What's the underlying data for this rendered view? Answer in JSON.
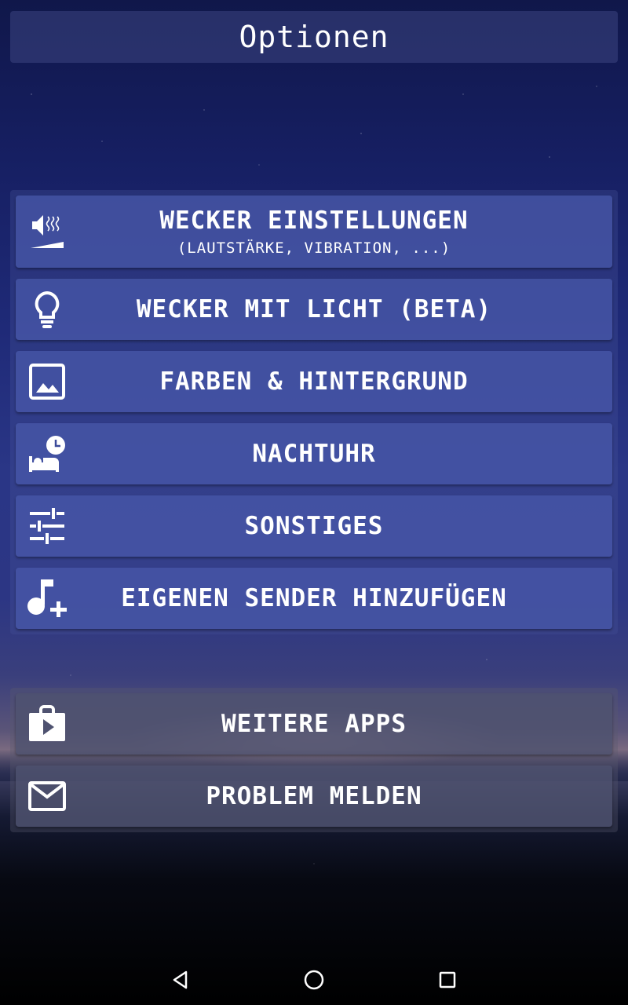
{
  "header": {
    "title": "Optionen"
  },
  "menu": [
    {
      "label": "WECKER EINSTELLUNGEN",
      "sub": "(LAUTSTÄRKE, VIBRATION, ...)",
      "icon": "volume-vibration-icon"
    },
    {
      "label": "WECKER MIT LICHT (BETA)",
      "icon": "lightbulb-icon"
    },
    {
      "label": "FARBEN & HINTERGRUND",
      "icon": "image-icon"
    },
    {
      "label": "NACHTUHR",
      "icon": "bed-clock-icon"
    },
    {
      "label": "SONSTIGES",
      "icon": "sliders-icon"
    },
    {
      "label": "EIGENEN SENDER HINZUFÜGEN",
      "icon": "music-add-icon"
    }
  ],
  "extra": [
    {
      "label": "WEITERE APPS",
      "icon": "play-store-icon"
    },
    {
      "label": "PROBLEM MELDEN",
      "icon": "mail-icon"
    }
  ],
  "navbar": {
    "back": "back-icon",
    "home": "home-icon",
    "recents": "recents-icon"
  }
}
